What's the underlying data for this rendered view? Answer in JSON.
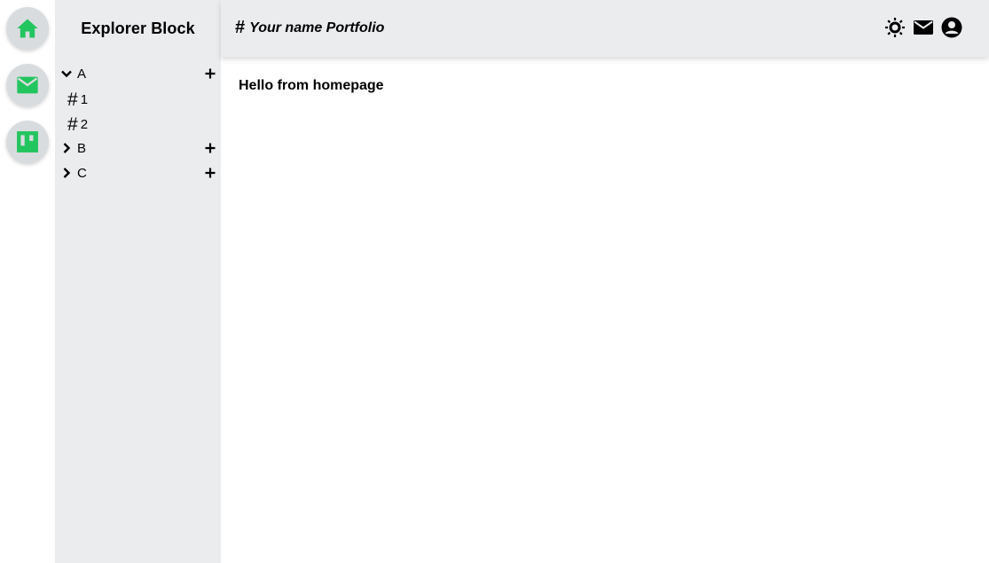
{
  "rail": {
    "items": [
      {
        "name": "home",
        "icon": "home-icon"
      },
      {
        "name": "mail",
        "icon": "mail-icon"
      },
      {
        "name": "board",
        "icon": "trello-board-icon"
      }
    ],
    "accent": "#22c55e"
  },
  "explorer": {
    "title": "Explorer Block",
    "folders": [
      {
        "label": "A",
        "expanded": true,
        "children": [
          "1",
          "2"
        ]
      },
      {
        "label": "B",
        "expanded": false
      },
      {
        "label": "C",
        "expanded": false
      }
    ],
    "hash_symbol": "#"
  },
  "topbar": {
    "hash_symbol": "#",
    "title": "Your name Portfolio",
    "icons": [
      "theme-sun-icon",
      "mail-icon",
      "account-icon"
    ]
  },
  "main": {
    "message": "Hello from homepage"
  }
}
